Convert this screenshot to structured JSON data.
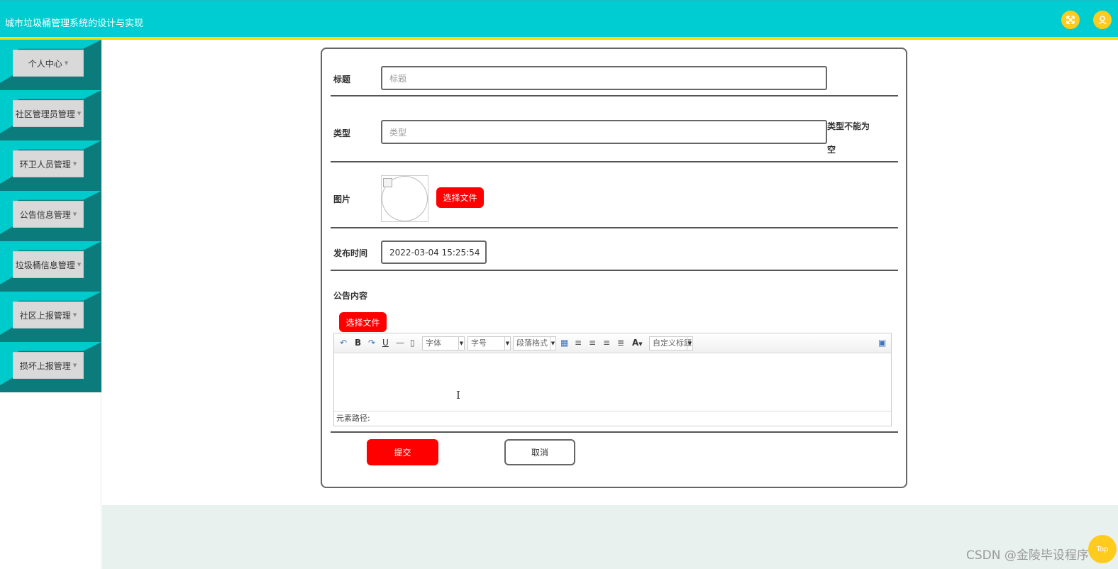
{
  "app": {
    "title": "城市垃圾桶管理系统的设计与实现",
    "fullscreen_icon": "expand-icon",
    "user_icon": "user-icon"
  },
  "sidebar": {
    "items": [
      {
        "label": "个人中心"
      },
      {
        "label": "社区管理员管理"
      },
      {
        "label": "环卫人员管理"
      },
      {
        "label": "公告信息管理"
      },
      {
        "label": "垃圾桶信息管理"
      },
      {
        "label": "社区上报管理"
      },
      {
        "label": "损坏上报管理"
      }
    ]
  },
  "form": {
    "title_label": "标题",
    "title_placeholder": "标题",
    "type_label": "类型",
    "type_placeholder": "类型",
    "type_error": "类型不能为空",
    "image_label": "图片",
    "choose_file": "选择文件",
    "publish_time_label": "发布时间",
    "publish_time_value": "2022-03-04 15:25:54",
    "content_label": "公告内容",
    "content_choose_file": "选择文件",
    "submit": "提交",
    "cancel": "取消"
  },
  "editor": {
    "toolbar": {
      "undo_icon": "undo-icon",
      "bold": "B",
      "redo_icon": "redo-icon",
      "underline": "U",
      "hr": "—",
      "font_family": "字体",
      "font_size": "字号",
      "paragraph": "段落格式",
      "font_color": "A",
      "custom_title": "自定义标题"
    },
    "status_path": "元素路径:"
  },
  "watermark": "CSDN @金陵毕设程序",
  "back_to_top": "Top",
  "colors": {
    "header": "#00cdd2",
    "header_line": "#ffe600",
    "accent_red": "#ff0000",
    "sidebar_teal": "#00cbcc",
    "sidebar_dark": "#0b7b7b",
    "footer_band": "#e8f1ed"
  }
}
